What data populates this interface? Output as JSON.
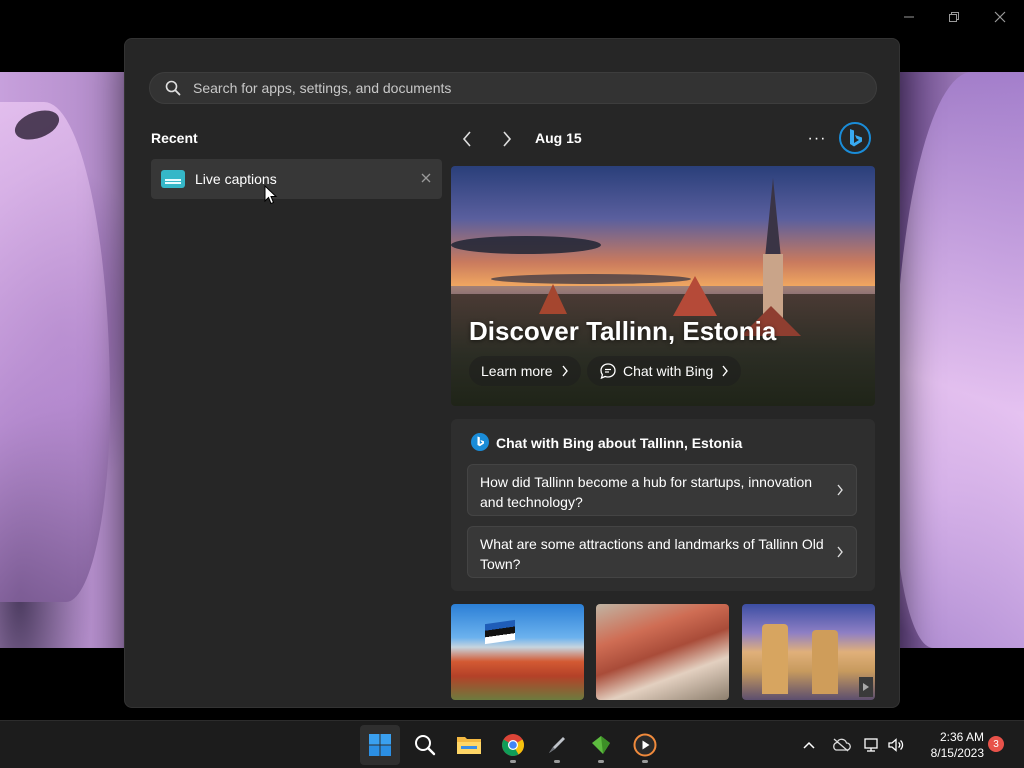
{
  "search": {
    "placeholder": "Search for apps, settings, and documents"
  },
  "recent": {
    "title": "Recent",
    "items": [
      {
        "label": "Live captions",
        "icon": "live-captions-icon"
      }
    ]
  },
  "feed": {
    "date": "Aug 15",
    "more_label": "···",
    "hero": {
      "title": "Discover Tallinn, Estonia",
      "learn_more": "Learn more",
      "chat_with_bing": "Chat with Bing"
    },
    "chat": {
      "title": "Chat with Bing about Tallinn, Estonia",
      "prompts": [
        "How did Tallinn become a hub for startups, innovation and technology?",
        "What are some attractions and landmarks of Tallinn Old Town?"
      ]
    }
  },
  "taskbar": {
    "apps": [
      "start-icon",
      "search-icon",
      "file-explorer-icon",
      "chrome-icon",
      "pen-app-icon",
      "green-app-icon",
      "media-player-icon"
    ],
    "time": "2:36 AM",
    "date": "8/15/2023",
    "notifications": "3"
  },
  "colors": {
    "accent": "#0067c0",
    "bing_blue": "#1a8cd8",
    "badge": "#e8524a"
  }
}
